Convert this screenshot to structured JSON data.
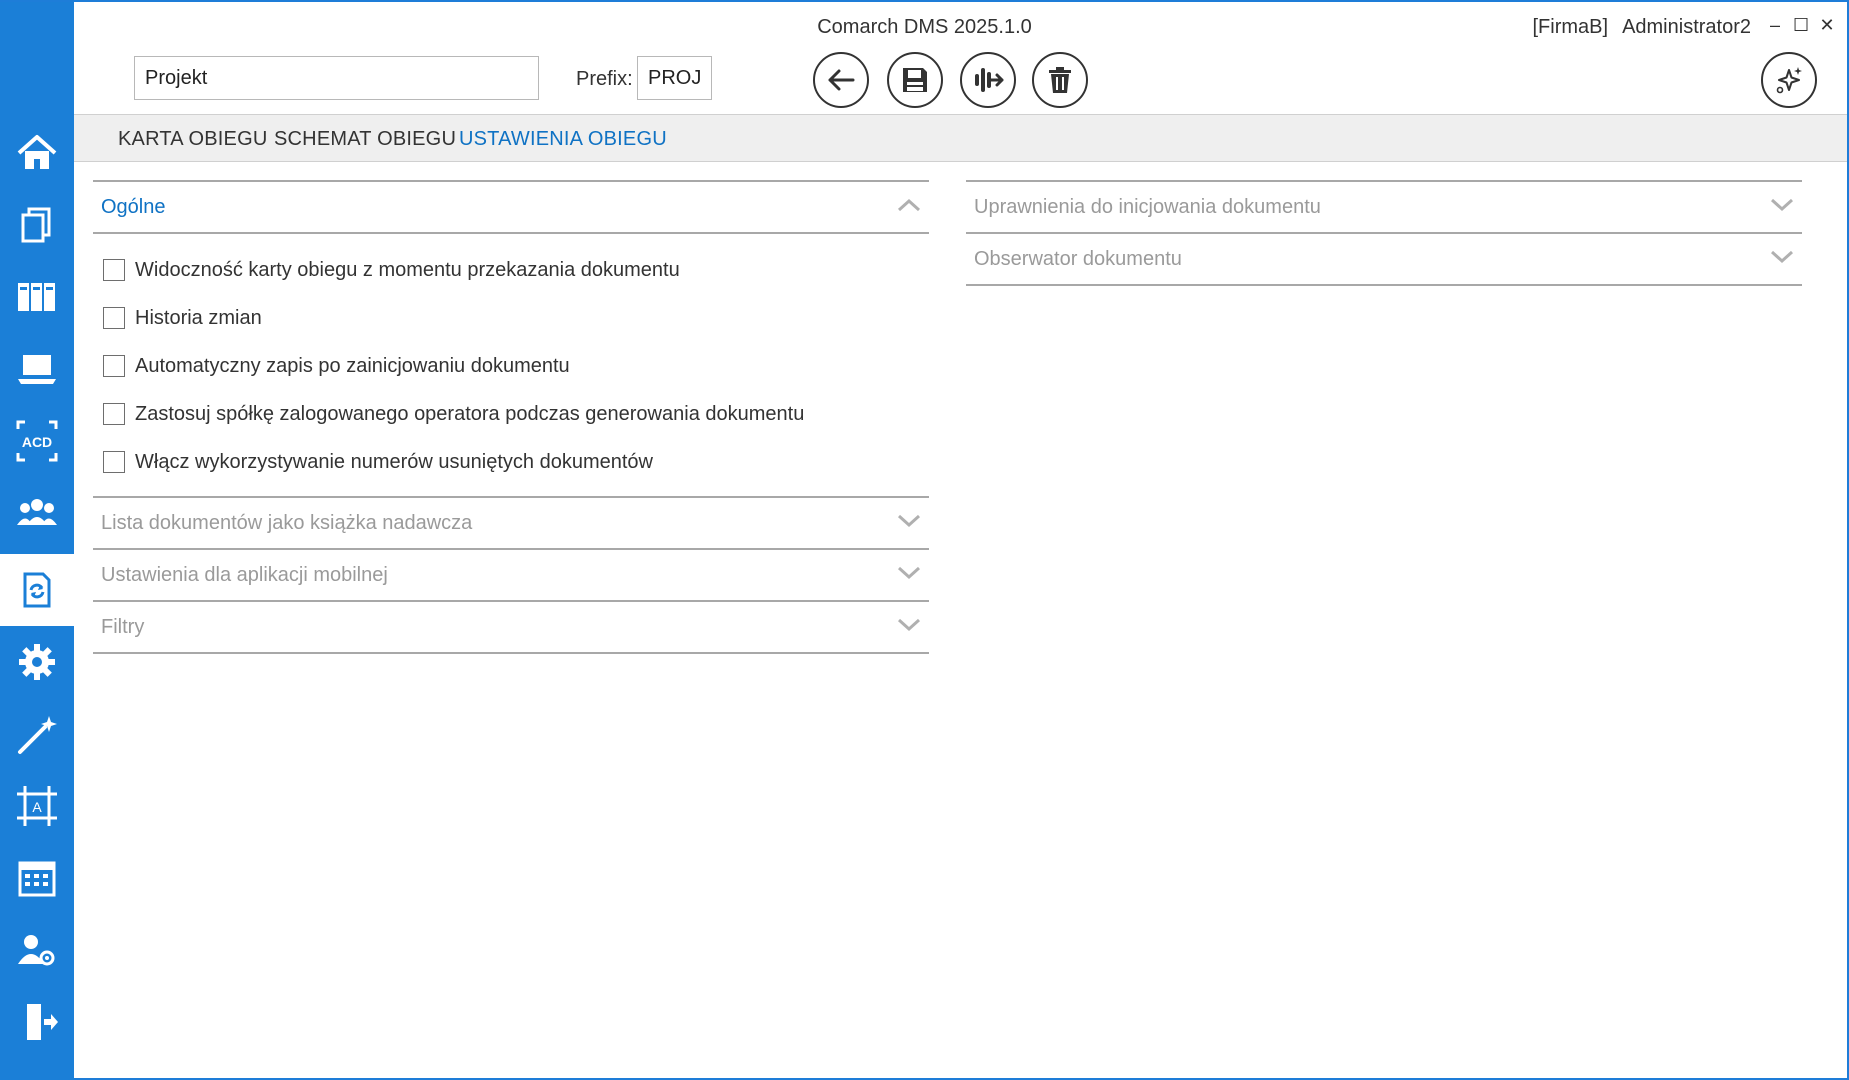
{
  "app": {
    "title": "Comarch DMS 2025.1.0",
    "company": "[FirmaB]",
    "user": "Administrator2",
    "minimize": "‒",
    "maximize": "☐",
    "close": "✕"
  },
  "sidebar": {
    "items": [
      {
        "icon": "home-icon"
      },
      {
        "icon": "documents-icon"
      },
      {
        "icon": "binders-icon"
      },
      {
        "icon": "laptop-icon"
      },
      {
        "icon": "acd-scan-icon"
      },
      {
        "icon": "users-icon"
      },
      {
        "icon": "workflow-document-icon",
        "active": true
      },
      {
        "icon": "settings-gear-icon"
      },
      {
        "icon": "magic-wand-icon"
      },
      {
        "icon": "text-frame-icon"
      },
      {
        "icon": "calendar-icon"
      },
      {
        "icon": "user-settings-icon"
      },
      {
        "icon": "logout-door-icon"
      }
    ]
  },
  "form": {
    "name_value": "Projekt",
    "prefix_label": "Prefix:",
    "prefix_value": "PROJ"
  },
  "toolbar": {
    "buttons": [
      "back-arrow-icon",
      "save-disk-icon",
      "merge-flow-icon",
      "trash-icon",
      "ai-sparkles-icon"
    ]
  },
  "tabs": [
    {
      "label": "KARTA OBIEGU",
      "active": false
    },
    {
      "label": "SCHEMAT OBIEGU",
      "active": false
    },
    {
      "label": "USTAWIENIA OBIEGU",
      "active": true
    }
  ],
  "left_sections": {
    "general": {
      "title": "Ogólne",
      "expanded": true,
      "options": [
        {
          "label": "Widoczność karty obiegu z momentu przekazania dokumentu",
          "checked": false
        },
        {
          "label": "Historia zmian",
          "checked": false
        },
        {
          "label": "Automatyczny zapis po zainicjowaniu dokumentu",
          "checked": false
        },
        {
          "label": "Zastosuj spółkę zalogowanego operatora podczas generowania dokumentu",
          "checked": false
        },
        {
          "label": "Włącz wykorzystywanie numerów usuniętych dokumentów",
          "checked": false
        }
      ]
    },
    "collapsed": [
      {
        "title": "Lista dokumentów jako książka nadawcza"
      },
      {
        "title": "Ustawienia dla aplikacji mobilnej"
      },
      {
        "title": "Filtry"
      }
    ]
  },
  "right_sections": [
    {
      "title": "Uprawnienia do inicjowania dokumentu"
    },
    {
      "title": "Obserwator dokumentu"
    }
  ],
  "colors": {
    "accent": "#1b7fd7",
    "active_text": "#0f72c4",
    "muted_text": "#9a9a9a"
  }
}
